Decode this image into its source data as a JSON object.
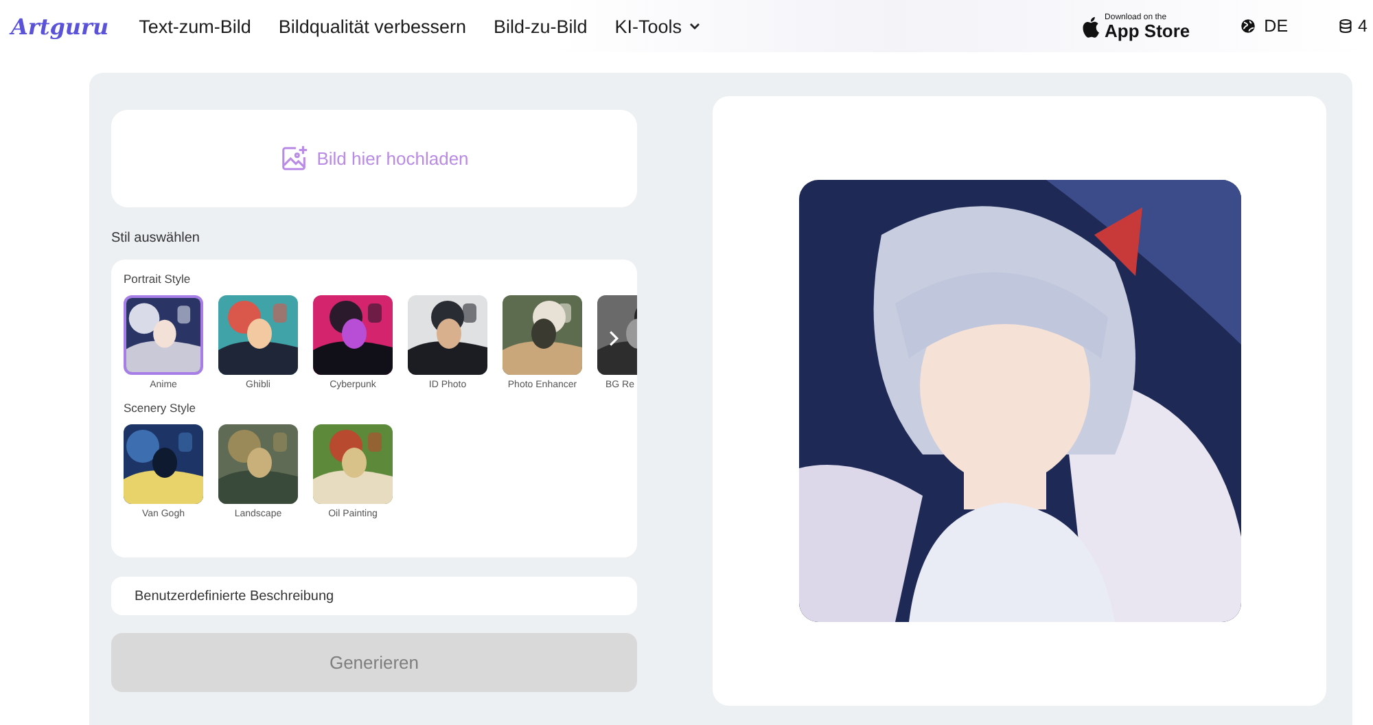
{
  "nav": {
    "logo": "Artguru",
    "links": [
      {
        "label": "Text-zum-Bild",
        "dropdown": false
      },
      {
        "label": "Bildqualität verbessern",
        "dropdown": false
      },
      {
        "label": "Bild-zu-Bild",
        "dropdown": false
      },
      {
        "label": "KI-Tools",
        "dropdown": true
      }
    ]
  },
  "app_store": {
    "small": "Download on the",
    "big": "App Store"
  },
  "language": "DE",
  "credits": "4",
  "upload": {
    "label": "Bild hier hochladen"
  },
  "style_heading": "Stil auswählen",
  "groups": [
    {
      "title": "Portrait Style",
      "more": true,
      "styles": [
        {
          "label": "Anime",
          "selected": true
        },
        {
          "label": "Ghibli",
          "selected": false
        },
        {
          "label": "Cyberpunk",
          "selected": false
        },
        {
          "label": "ID Photo",
          "selected": false
        },
        {
          "label": "Photo Enhancer",
          "selected": false
        },
        {
          "label": "BG Re",
          "selected": false
        }
      ]
    },
    {
      "title": "Scenery Style",
      "more": false,
      "styles": [
        {
          "label": "Van Gogh",
          "selected": false
        },
        {
          "label": "Landscape",
          "selected": false
        },
        {
          "label": "Oil Painting",
          "selected": false
        }
      ]
    }
  ],
  "description": {
    "placeholder": "Benutzerdefinierte Beschreibung"
  },
  "generate": {
    "label": "Generieren",
    "disabled": true
  }
}
